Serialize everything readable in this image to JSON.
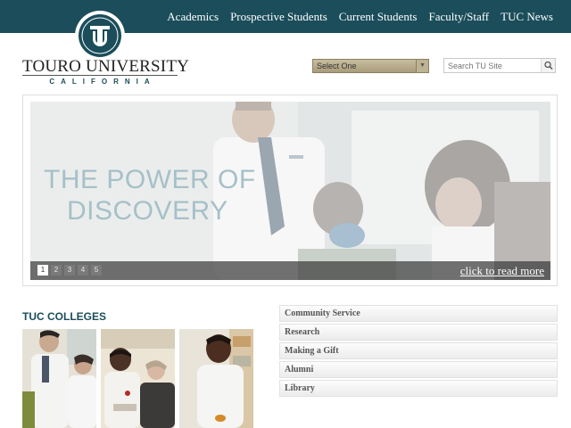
{
  "nav": {
    "items": [
      "Academics",
      "Prospective Students",
      "Current Students",
      "Faculty/Staff",
      "TUC News"
    ]
  },
  "logo": {
    "seal_text": "TU",
    "name": "TOURO UNIVERSITY",
    "subtitle": "CALIFORNIA"
  },
  "select": {
    "value": "Select One"
  },
  "search": {
    "placeholder": "Search TU Site"
  },
  "hero": {
    "line1": "THE POWER OF",
    "line2": "DISCOVERY",
    "pages": [
      "1",
      "2",
      "3",
      "4",
      "5"
    ],
    "active_page": "1",
    "read_more": "click to read more"
  },
  "colleges": {
    "title": "TUC COLLEGES"
  },
  "links": [
    "Community Service",
    "Research",
    "Making a Gift",
    "Alumni",
    "Library"
  ],
  "colors": {
    "brand_teal": "#1b4d5a",
    "hero_text": "#a6c0c8",
    "select_bg": "#b3a888"
  },
  "icons": {
    "search_button": "magnifier-icon",
    "select_arrow": "triangle-down-icon"
  }
}
